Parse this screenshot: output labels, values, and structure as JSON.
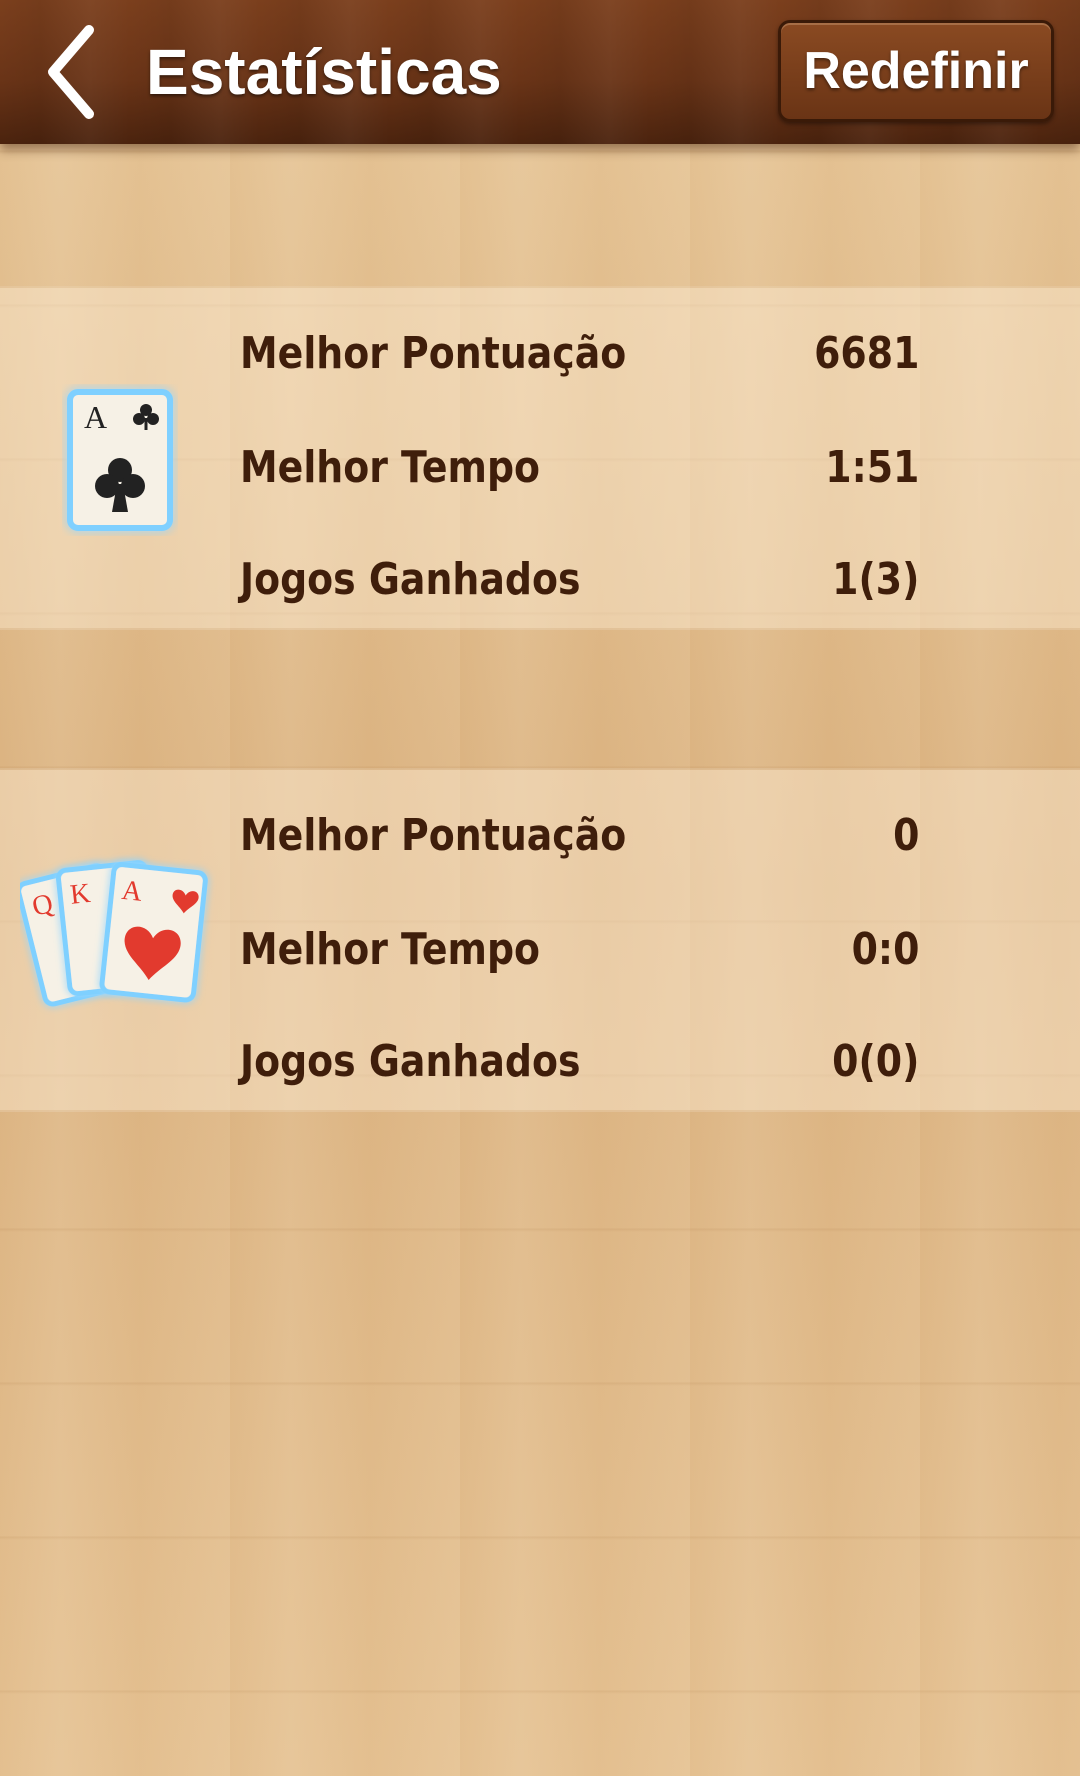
{
  "header": {
    "title": "Estatísticas",
    "reset_label": "Redefinir"
  },
  "colors": {
    "header_wood": "#6a3417",
    "text_brown": "#3f1e0b",
    "card_glow": "#7fd0ff",
    "suit_black": "#222222",
    "suit_red": "#e23a2e"
  },
  "stats": [
    {
      "game_icon": "single-ace-of-clubs-card-icon",
      "card_rank": "A",
      "rows": [
        {
          "label": "Melhor Pontuação",
          "value": "6681"
        },
        {
          "label": "Melhor Tempo",
          "value": "1:51"
        },
        {
          "label": "Jogos Ganhados",
          "value": "1(3)"
        }
      ]
    },
    {
      "game_icon": "fanned-hearts-cards-icon",
      "card_ranks": [
        "Q",
        "K",
        "A"
      ],
      "rows": [
        {
          "label": "Melhor Pontuação",
          "value": "0"
        },
        {
          "label": "Melhor Tempo",
          "value": "0:0"
        },
        {
          "label": "Jogos Ganhados",
          "value": "0(0)"
        }
      ]
    }
  ]
}
